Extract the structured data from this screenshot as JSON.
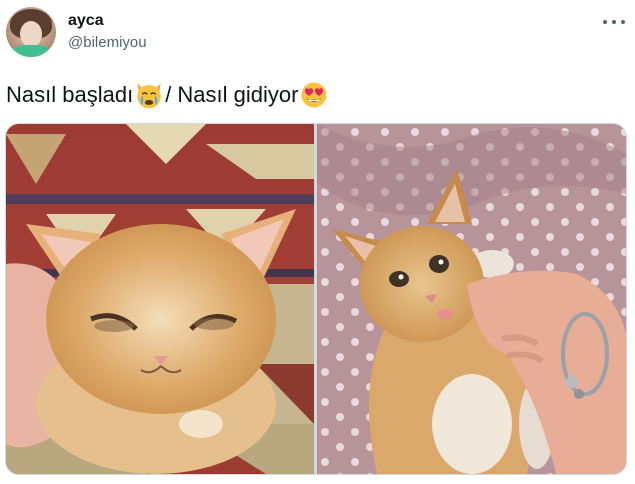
{
  "author": {
    "display_name": "ayca",
    "handle": "@bilemiyou",
    "avatar_icon": "profile-photo"
  },
  "menu": {
    "icon": "more-options-icon"
  },
  "tweet": {
    "text_part1": "Nasıl başladı",
    "emoji1": "crying-cat-face-emoji",
    "text_part2": "/ Nasıl gidiyor",
    "emoji2": "smiling-face-with-heart-eyes-emoji"
  },
  "media": {
    "photos": [
      {
        "name": "sick-kitten-photo"
      },
      {
        "name": "healthy-kitten-photo"
      }
    ]
  },
  "colors": {
    "text": "#0f1419",
    "secondary_text": "#536471",
    "border": "#cfd9de"
  }
}
